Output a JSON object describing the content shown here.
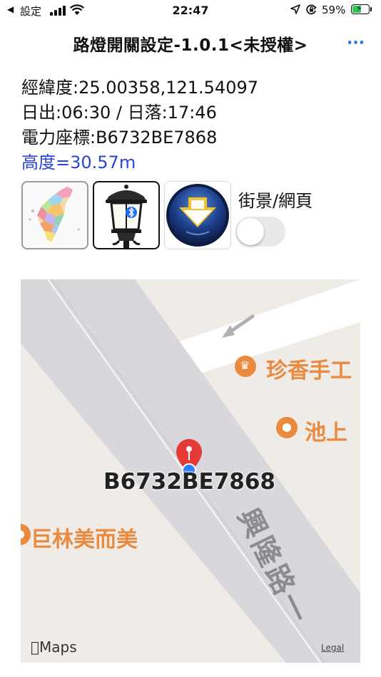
{
  "status_bar": {
    "back_label": "設定",
    "time": "22:47",
    "battery_percent": "59%",
    "battery_level": 0.59,
    "icons": [
      "back-arrow-icon",
      "signal-icon",
      "wifi-icon",
      "location-icon",
      "rotation-lock-icon",
      "battery-charging-icon"
    ]
  },
  "nav": {
    "title": "路燈開關設定-1.0.1<未授權>",
    "more_label": "···"
  },
  "info": {
    "coords": "經緯度:25.00358,121.54097",
    "sun": "日出:06:30 / 日落:17:46",
    "meter": "電力座標:B6732BE7868",
    "altitude": "高度=30.57m"
  },
  "buttons": {
    "icons": [
      "taiwan-map-icon",
      "street-lamp-bluetooth-icon",
      "download-icon"
    ]
  },
  "toggle": {
    "label": "街景/網頁",
    "on": false
  },
  "map": {
    "pois": [
      {
        "label": "珍香手工",
        "icon": "bakery-icon"
      },
      {
        "label": "池上",
        "icon": "restaurant-icon"
      },
      {
        "label": "巨林美而美",
        "icon": "restaurant-icon"
      }
    ],
    "road_name": "興隆路一",
    "marker_label": "B6732BE7868",
    "attribution": "Maps",
    "legal": "Legal",
    "colors": {
      "road": "#d8d8dc",
      "poi": "#e98a3e",
      "pin": "#e53935",
      "location": "#2f7cf6"
    }
  }
}
